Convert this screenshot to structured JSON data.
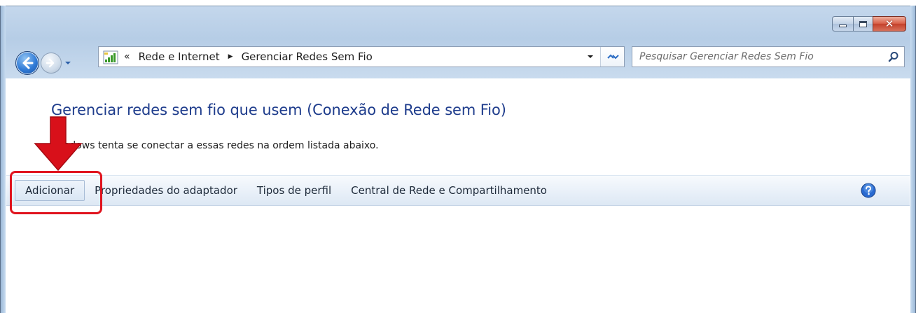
{
  "window": {
    "controls": {
      "minimize": "minimize",
      "maximize": "maximize",
      "close": "✕"
    }
  },
  "nav": {
    "back_icon": "back-arrow-icon",
    "forward_icon": "forward-arrow-icon"
  },
  "address_bar": {
    "overflow": "«",
    "breadcrumbs": [
      "Rede e Internet",
      "Gerenciar Redes Sem Fio"
    ],
    "icon": "network-signal-icon"
  },
  "search": {
    "placeholder": "Pesquisar Gerenciar Redes Sem Fio",
    "value": ""
  },
  "page": {
    "title": "Gerenciar redes sem fio que usem (Conexão de Rede sem Fio)",
    "subtitle": "Windows tenta se conectar a essas redes na ordem listada abaixo."
  },
  "toolbar": {
    "add_label": "Adicionar",
    "adapter_properties_label": "Propriedades do adaptador",
    "profile_types_label": "Tipos de perfil",
    "network_center_label": "Central de Rede e Compartilhamento"
  },
  "colors": {
    "title_blue": "#1e3c8c",
    "highlight_red": "#e0141e",
    "frame_blue": "#b6cde6"
  }
}
